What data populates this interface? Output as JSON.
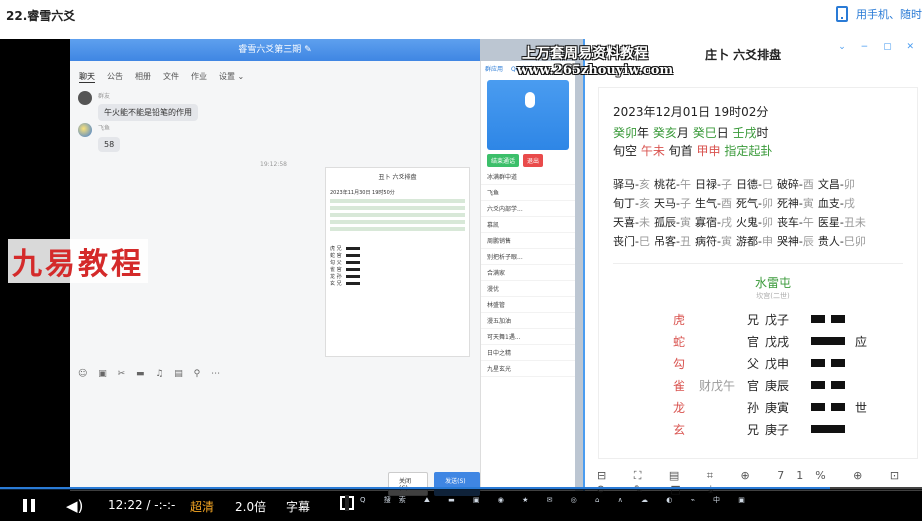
{
  "page": {
    "title": "22.睿雪六爻",
    "phone_link": "用手机、随时"
  },
  "chat": {
    "window_title": "睿雪六爻第三期 ✎",
    "tabs": [
      "聊天",
      "公告",
      "相册",
      "文件",
      "作业",
      "设置 ⌄"
    ],
    "messages": [
      {
        "name": "群友",
        "text": "午火能不能是铅笔的作用"
      },
      {
        "name": "飞鱼",
        "text": "58"
      }
    ],
    "time": "19:12:58",
    "mini_title": "丑卜 六爻排盘",
    "mini_date": "2023年11月30日 19时50分",
    "toolbar_icons": "☺ ▣ ✂ ▬ ♫ ▤ ⚲ ⋯",
    "close_button": "关闭(C)",
    "send_button": "发送(S) ⌄"
  },
  "qq_panel": {
    "tabs": [
      "群应用",
      "QQ电话"
    ],
    "call_end": "结束通话",
    "hangup": "退出",
    "members": [
      "冰满群中道",
      "飞鱼",
      "六爻内部学...",
      "慕凯",
      "周鹏销售",
      "别把析子眼...",
      "合满家",
      "漫优",
      "林盛管",
      "漫五加油",
      "可天舞1遇...",
      "日中之精",
      "九星玄光"
    ]
  },
  "paipan": {
    "window_title": "庄卜 六爻排盘",
    "date": "2023年12月01日 19时02分",
    "ganzhi": [
      {
        "t": "癸卯",
        "c": "green"
      },
      {
        "t": "年 ",
        "c": ""
      },
      {
        "t": "癸亥",
        "c": "green"
      },
      {
        "t": "月 ",
        "c": ""
      },
      {
        "t": "癸巳",
        "c": "green"
      },
      {
        "t": "日 ",
        "c": ""
      },
      {
        "t": "壬戌",
        "c": "green"
      },
      {
        "t": "时",
        "c": ""
      }
    ],
    "xunkong": [
      {
        "t": "旬空 ",
        "c": ""
      },
      {
        "t": "午未",
        "c": "red"
      },
      {
        "t": " 旬首 ",
        "c": ""
      },
      {
        "t": "甲申",
        "c": "red"
      },
      {
        "t": " 指定起卦",
        "c": "green"
      }
    ],
    "shensha_rows": [
      [
        [
          "驿马-",
          "亥"
        ],
        [
          "桃花-",
          "午"
        ],
        [
          "日禄-",
          "子"
        ],
        [
          "日德-",
          "巳"
        ],
        [
          "破碎-",
          "酉"
        ],
        [
          "文昌-",
          "卯"
        ]
      ],
      [
        [
          "旬丁-",
          "亥"
        ],
        [
          "天马-",
          "子"
        ],
        [
          "生气-",
          "酉"
        ],
        [
          "死气-",
          "卯"
        ],
        [
          "死神-",
          "寅"
        ],
        [
          "血支-",
          "戌"
        ]
      ],
      [
        [
          "天喜-",
          "未"
        ],
        [
          "孤辰-",
          "寅"
        ],
        [
          "寡宿-",
          "戌"
        ],
        [
          "火鬼-",
          "卯"
        ],
        [
          "丧车-",
          "午"
        ],
        [
          "医星-",
          "丑未"
        ]
      ],
      [
        [
          "丧门-",
          "巳"
        ],
        [
          "吊客-",
          "丑"
        ],
        [
          "病符-",
          "寅"
        ],
        [
          "游都-",
          "申"
        ],
        [
          "哭神-",
          "辰"
        ],
        [
          "贵人-",
          "巳卯"
        ]
      ]
    ],
    "gua_name": "水雷屯",
    "gua_sub": "坎宫(二世)",
    "yao": [
      {
        "beast": "虎",
        "fu": "",
        "liuqin": "兄",
        "gz": "戊子",
        "type": "yin",
        "mark": ""
      },
      {
        "beast": "蛇",
        "fu": "",
        "liuqin": "官",
        "gz": "戊戌",
        "type": "yang",
        "mark": "应"
      },
      {
        "beast": "勾",
        "fu": "",
        "liuqin": "父",
        "gz": "戊申",
        "type": "yin",
        "mark": ""
      },
      {
        "beast": "雀",
        "fu": "财戊午",
        "liuqin": "官",
        "gz": "庚辰",
        "type": "yin",
        "mark": ""
      },
      {
        "beast": "龙",
        "fu": "",
        "liuqin": "孙",
        "gz": "庚寅",
        "type": "yin",
        "mark": "世"
      },
      {
        "beast": "玄",
        "fu": "",
        "liuqin": "兄",
        "gz": "庚子",
        "type": "yang",
        "mark": ""
      }
    ],
    "tools": "⊟ ⛶ ▤ ⌗ ⊕ 71% ⊕ ⊡ ⟳ ✎ ⬒ ⤓",
    "zoom": "71%"
  },
  "overlays": {
    "top_text": "上万套周易资料教程",
    "url": "www.265zhouyiw.com",
    "left_text": "九易教程"
  },
  "player": {
    "time": "12:22 / -:-:-",
    "quality": "超清",
    "speed": "2.0倍",
    "subtitle": "字幕",
    "progress": 0.9,
    "taskbar": "Q 搜索  ⛰ ▬ ▣ ◉ ★ ✉ ◎ ⌂  ∧ ☁ ◐ ⌁ 中 ▣"
  }
}
